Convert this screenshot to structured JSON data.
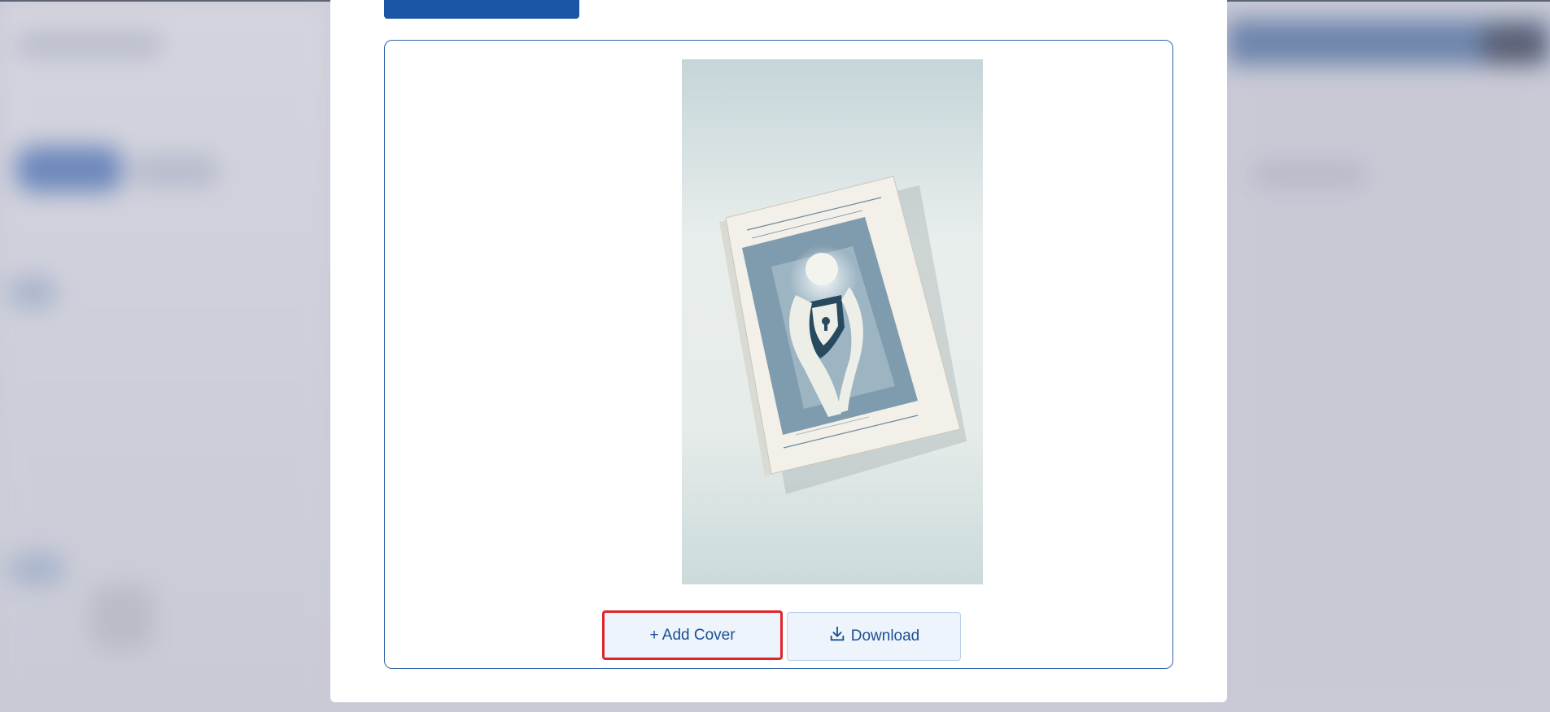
{
  "modal": {
    "cover_image": {
      "icon": "book-cover-image"
    },
    "buttons": {
      "add_cover_label": "+ Add Cover",
      "download_label": "Download"
    }
  },
  "colors": {
    "accent": "#1a56a4",
    "button_text": "#1a4f93",
    "highlight": "#e0242b",
    "button_bg": "#eef4fb"
  }
}
